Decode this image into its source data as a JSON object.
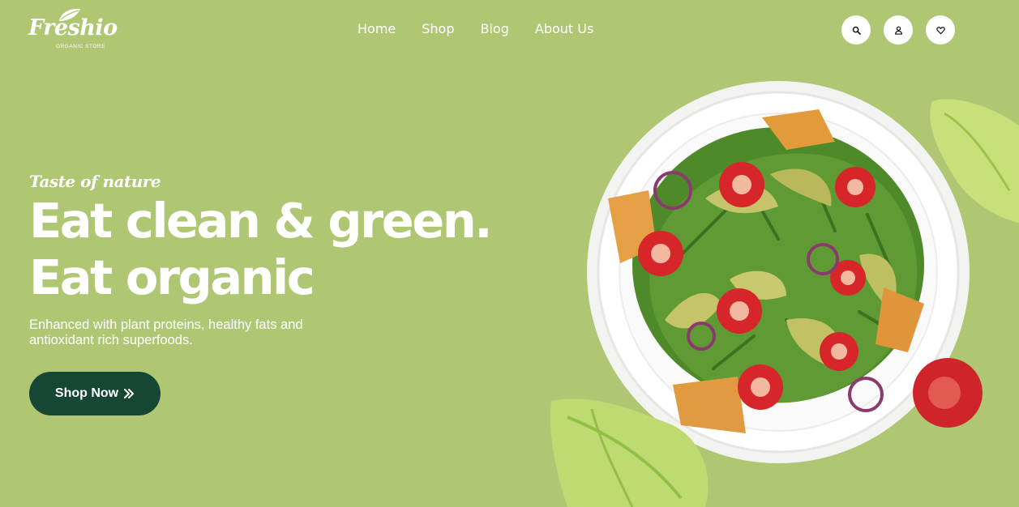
{
  "brand": {
    "name": "Freshio",
    "subtitle": "ORGANIC STORE"
  },
  "nav": {
    "items": [
      {
        "label": "Home"
      },
      {
        "label": "Shop"
      },
      {
        "label": "Blog"
      },
      {
        "label": "About Us"
      }
    ]
  },
  "header_icons": [
    "search-icon",
    "user-icon",
    "heart-icon"
  ],
  "hero": {
    "tagline": "Taste of nature",
    "headline_line1": "Eat clean & green.",
    "headline_line2": "Eat organic",
    "description": "Enhanced with plant proteins, healthy fats and antioxidant rich superfoods.",
    "cta_label": "Shop Now"
  },
  "colors": {
    "background": "#afc673",
    "cta_background": "#154734",
    "text": "#ffffff"
  }
}
